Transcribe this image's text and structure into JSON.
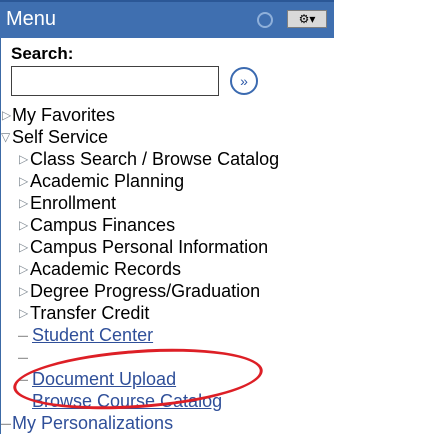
{
  "header": {
    "title": "Menu",
    "options_label": "⚙▾"
  },
  "search": {
    "label": "Search:",
    "value": "",
    "go_label": "»"
  },
  "menu": {
    "my_favorites": "My Favorites",
    "self_service": "Self Service",
    "children": [
      "Class Search / Browse Catalog",
      "Academic Planning",
      "Enrollment",
      "Campus Finances",
      "Campus Personal Information",
      "Academic Records",
      "Degree Progress/Graduation",
      "Transfer Credit"
    ],
    "links": [
      "Student Center",
      "Document Upload",
      "Browse Course Catalog"
    ],
    "my_personalizations": "My Personalizations"
  },
  "annotation_color": "#dd1f26"
}
